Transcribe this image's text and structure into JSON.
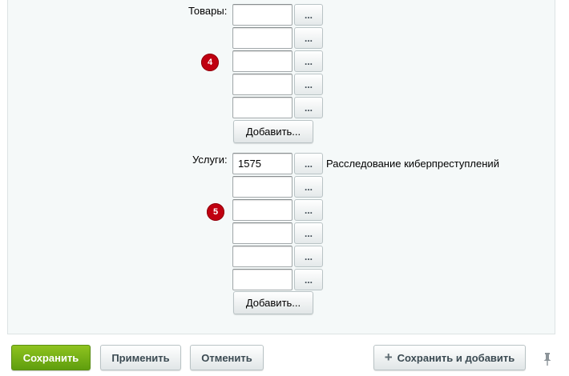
{
  "goods": {
    "label": "Товары:",
    "badge": "4",
    "items": [
      {
        "value": ""
      },
      {
        "value": ""
      },
      {
        "value": ""
      },
      {
        "value": ""
      },
      {
        "value": ""
      }
    ],
    "select_label": "...",
    "add_label": "Добавить..."
  },
  "services": {
    "label": "Услуги:",
    "badge": "5",
    "items": [
      {
        "value": "1575",
        "description": "Расследование киберпреступлений"
      },
      {
        "value": ""
      },
      {
        "value": ""
      },
      {
        "value": ""
      },
      {
        "value": ""
      },
      {
        "value": ""
      }
    ],
    "select_label": "...",
    "add_label": "Добавить..."
  },
  "footer": {
    "save_label": "Сохранить",
    "apply_label": "Применить",
    "cancel_label": "Отменить",
    "save_add_label": "Сохранить и добавить",
    "save_add_icon": "plus-icon",
    "pin_icon": "pin-icon"
  },
  "colors": {
    "save_button": "#6fae14",
    "badge": "#c00011",
    "panel_background": "#f5f9f9"
  }
}
